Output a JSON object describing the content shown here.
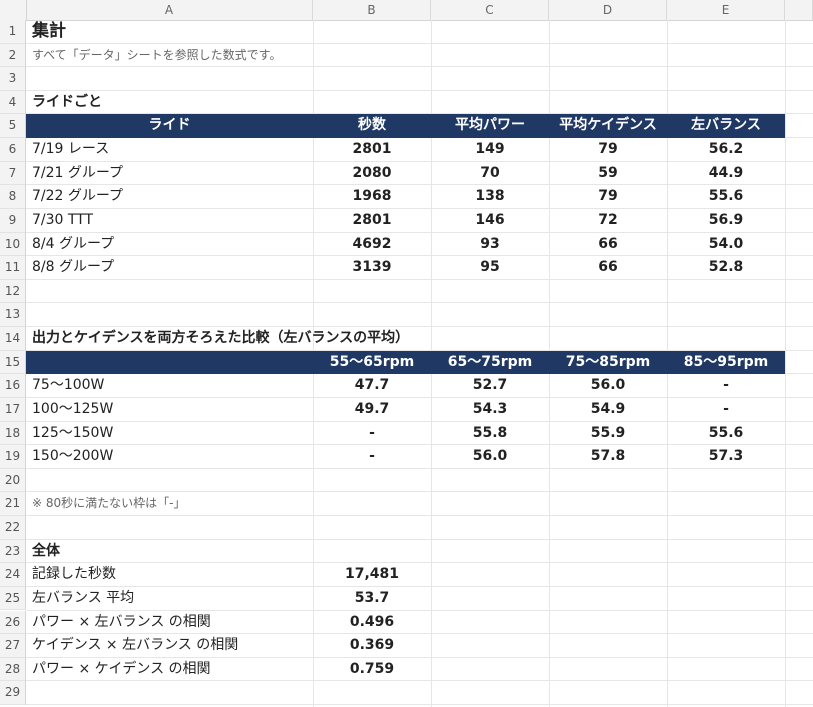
{
  "columns": [
    "A",
    "B",
    "C",
    "D",
    "E"
  ],
  "rows": [
    "1",
    "2",
    "3",
    "4",
    "5",
    "6",
    "7",
    "8",
    "9",
    "10",
    "11",
    "12",
    "13",
    "14",
    "15",
    "16",
    "17",
    "18",
    "19",
    "20",
    "21",
    "22",
    "23",
    "24",
    "25",
    "26",
    "27",
    "28",
    "29"
  ],
  "title": "集計",
  "subtitle": "すべて「データ」シートを参照した数式です。",
  "rides_section": "ライドごと",
  "rides_headers": [
    "ライド",
    "秒数",
    "平均パワー",
    "平均ケイデンス",
    "左バランス"
  ],
  "rides": [
    {
      "name": "7/19 レース",
      "sec": "2801",
      "power": "149",
      "cad": "79",
      "bal": "56.2"
    },
    {
      "name": "7/21 グループ",
      "sec": "2080",
      "power": "70",
      "cad": "59",
      "bal": "44.9"
    },
    {
      "name": "7/22 グループ",
      "sec": "1968",
      "power": "138",
      "cad": "79",
      "bal": "55.6"
    },
    {
      "name": "7/30 TTT",
      "sec": "2801",
      "power": "146",
      "cad": "72",
      "bal": "56.9"
    },
    {
      "name": "8/4 グループ",
      "sec": "4692",
      "power": "93",
      "cad": "66",
      "bal": "54.0"
    },
    {
      "name": "8/8 グループ",
      "sec": "3139",
      "power": "95",
      "cad": "66",
      "bal": "52.8"
    }
  ],
  "compare_section": "出力とケイデンスを両方そろえた比較（左バランスの平均）",
  "compare_headers": [
    "",
    "55〜65rpm",
    "65〜75rpm",
    "75〜85rpm",
    "85〜95rpm"
  ],
  "compare_rows": [
    {
      "label": "75〜100W",
      "v": [
        "47.7",
        "52.7",
        "56.0",
        "-"
      ]
    },
    {
      "label": "100〜125W",
      "v": [
        "49.7",
        "54.3",
        "54.9",
        "-"
      ]
    },
    {
      "label": "125〜150W",
      "v": [
        "-",
        "55.8",
        "55.9",
        "55.6"
      ]
    },
    {
      "label": "150〜200W",
      "v": [
        "-",
        "56.0",
        "57.8",
        "57.3"
      ]
    }
  ],
  "note": "※ 80秒に満たない枠は「-」",
  "overall_section": "全体",
  "overall": [
    {
      "label": "記録した秒数",
      "value": "17,481"
    },
    {
      "label": "左バランス 平均",
      "value": "53.7"
    },
    {
      "label": "パワー × 左バランス の相関",
      "value": "0.496"
    },
    {
      "label": "ケイデンス × 左バランス の相関",
      "value": "0.369"
    },
    {
      "label": "パワー × ケイデンス の相関",
      "value": "0.759"
    }
  ],
  "colors": {
    "header_band": "#1f3864",
    "header_text": "#ffffff",
    "gridline": "#e6e6e6"
  }
}
